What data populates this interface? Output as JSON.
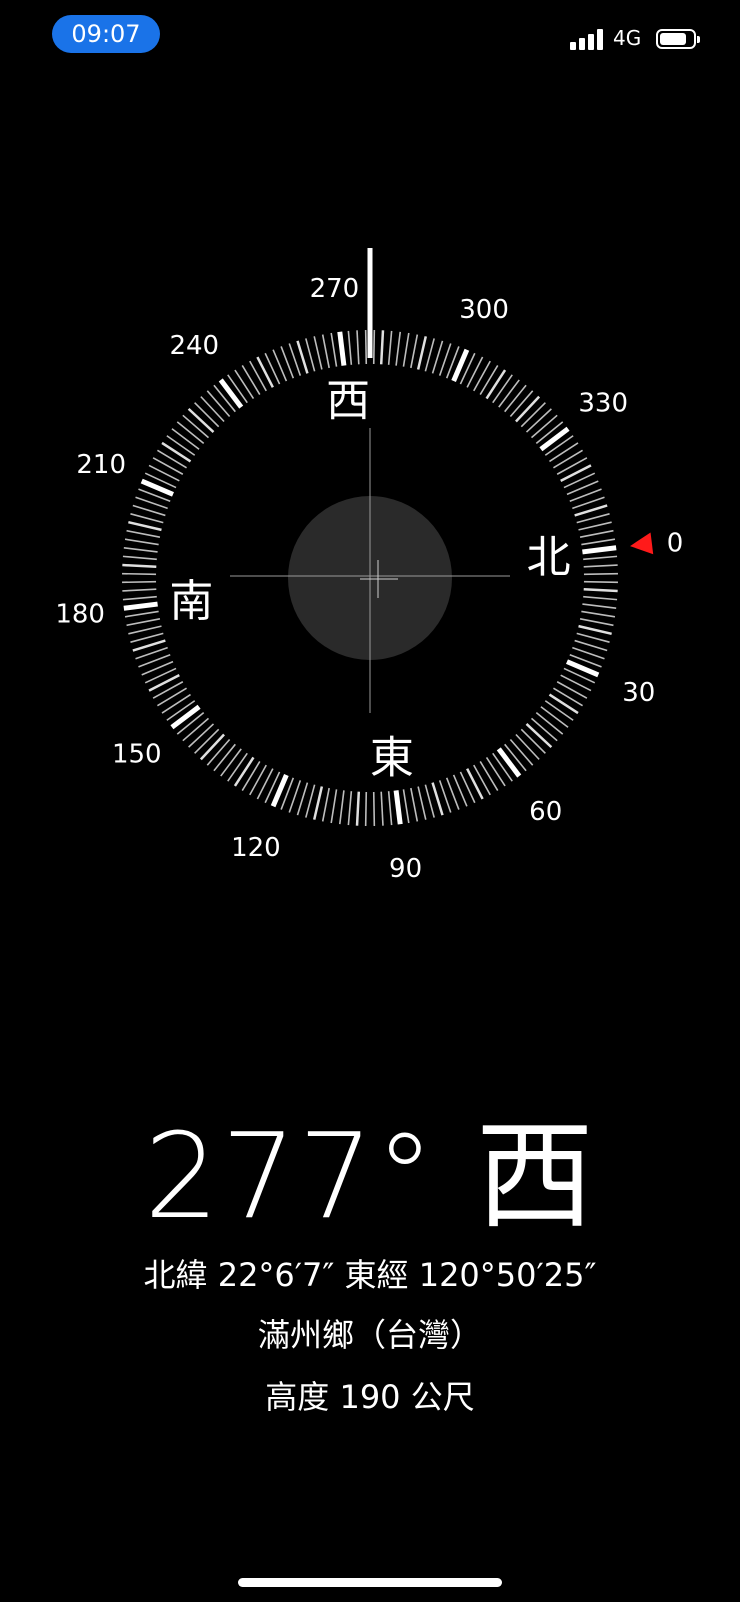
{
  "status": {
    "time": "09:07",
    "network": "4G",
    "icons": [
      "signal-icon",
      "battery-icon"
    ]
  },
  "compass": {
    "rotation_deg": 277,
    "degree_labels": [
      {
        "deg": 0,
        "text": "0"
      },
      {
        "deg": 30,
        "text": "30"
      },
      {
        "deg": 60,
        "text": "60"
      },
      {
        "deg": 90,
        "text": "90"
      },
      {
        "deg": 120,
        "text": "120"
      },
      {
        "deg": 150,
        "text": "150"
      },
      {
        "deg": 180,
        "text": "180"
      },
      {
        "deg": 210,
        "text": "210"
      },
      {
        "deg": 240,
        "text": "240"
      },
      {
        "deg": 270,
        "text": "270"
      },
      {
        "deg": 300,
        "text": "300"
      },
      {
        "deg": 330,
        "text": "330"
      }
    ],
    "cardinals": [
      {
        "deg": 0,
        "text": "北"
      },
      {
        "deg": 90,
        "text": "東"
      },
      {
        "deg": 180,
        "text": "南"
      },
      {
        "deg": 270,
        "text": "西"
      }
    ],
    "north_marker_color": "#ff1a1a"
  },
  "readout": {
    "heading": "277° 西",
    "coordinates": "北緯 22°6′7″  東經 120°50′25″",
    "place": "滿州鄉（台灣）",
    "altitude": "高度 190 公尺"
  }
}
